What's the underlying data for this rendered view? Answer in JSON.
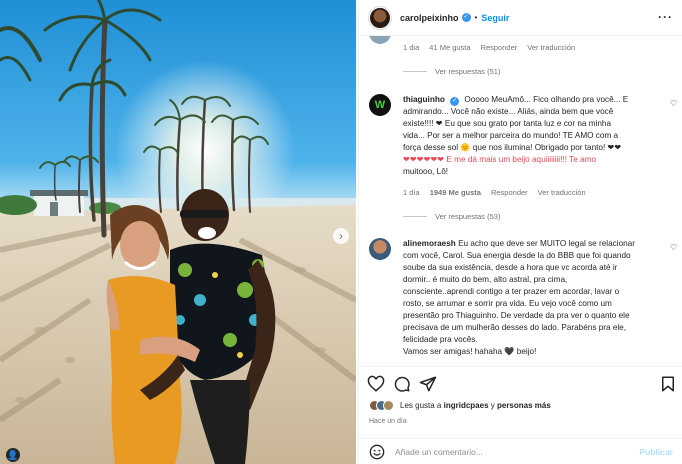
{
  "header": {
    "username": "carolpeixinho",
    "verified_mark": "✓",
    "separator": "•",
    "follow_label": "Seguir",
    "more_label": "···"
  },
  "comments": {
    "top_meta": {
      "time": "1 dia",
      "likes": "41 Me gusta",
      "reply": "Responder",
      "translate": "Ver traducción"
    },
    "top_replies": "Ver respuestas (51)",
    "thiaguinho": {
      "username": "thiaguinho",
      "lines": [
        "Ooooo MeuAmô... Fico olhando pra você... E",
        "admirando... Você não existe... Aliás, ainda bem que você",
        "existe!!!! ❤ Eu que sou grato por tanta luz e cor na minha",
        "vida... Por ser a melhor parceira do mundo! TE AMO com a",
        "força desse sol 🌞 que nos ilumina! Obrigado por tanto! ❤❤",
        "❤❤❤❤❤❤ E me dá mais um beijo aquiiiiiiii!!! Te amo",
        "muitooo, Lô!"
      ],
      "meta": {
        "time": "1 día",
        "likes": "1949 Me gusta",
        "reply": "Responder",
        "translate": "Ver traducción"
      },
      "replies": "Ver respuestas (53)"
    },
    "aline": {
      "username": "alinemoraesh",
      "lines": [
        "Eu acho que deve ser MUITO legal se relacionar",
        "com você, Carol. Sua energia desde la do BBB que foi quando",
        "soube da sua existência, desde a hora que vc acorda até ir",
        "dormir.. é muito do bem, alto astral, pra cima,",
        "consciente..aprendi contigo a ter prazer em acordar, lavar o",
        "rosto, se arrumar e sorrir pra vida. Eu vejo você como um",
        "presentão pro Thiaguinho. De verdade da pra ver o quanto ele",
        "precisava de um mulherão desses do lado. Parabéns pra ele,",
        "felicidade pra vocês.",
        "Vamos ser amigas! hahaha 🖤 beijo!"
      ]
    }
  },
  "likes": {
    "prefix": "Les gusta a",
    "user": "ingridcpaes",
    "connector": "y",
    "others": "personas más"
  },
  "post_time": "Hace un día",
  "add_comment": {
    "placeholder": "Añade un comentario...",
    "publish_label": "Publicar"
  },
  "colors": {
    "accent": "#0095f6",
    "verified": "#3897f0",
    "heart_red": "#ed4956",
    "publish_disabled": "#b2dffc"
  }
}
